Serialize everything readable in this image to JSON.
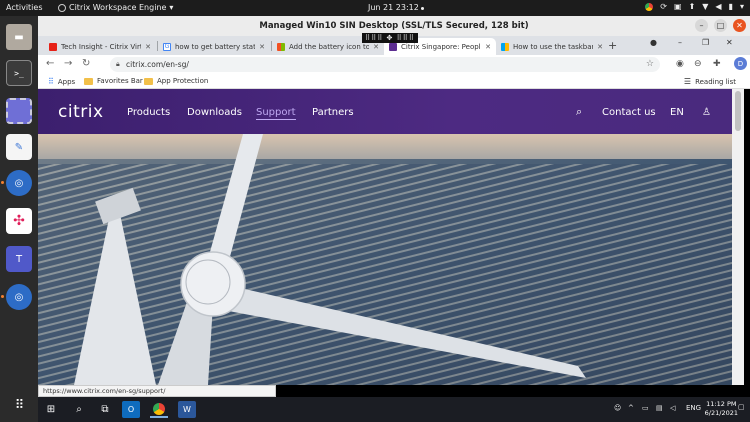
{
  "topbar": {
    "activities": "Activities",
    "app_name": "Citrix Workspace Engine",
    "clock": "Jun 21  23:12"
  },
  "citrix": {
    "title": "Managed Win10 SIN Desktop (SSL/TLS Secured, 128 bit)",
    "toolbar_handle": "⠿⠿⠿ ✥ ⠿⠿⠿"
  },
  "browser": {
    "tabs": [
      {
        "label": "Tech Insight - Citrix Virtual",
        "favicon_color": "#e62117"
      },
      {
        "label": "how to get battery status",
        "favicon_color": "#4285f4"
      },
      {
        "label": "Add the battery icon to th",
        "favicon_color": "#00a4ef"
      },
      {
        "label": "Citrix Singapore: People-c",
        "favicon_color": "#5c2d91"
      },
      {
        "label": "How to use the taskbar in",
        "favicon_color": "#00a4ef"
      }
    ],
    "new_tab": "+",
    "url": "citrix.com/en-sg/",
    "profile_initial": "D",
    "bookmarks": {
      "apps": "Apps",
      "favorites": "Favorites Bar",
      "app_protection": "App Protection",
      "reading_list": "Reading list"
    },
    "status_url": "https://www.citrix.com/en-sg/support/"
  },
  "site": {
    "logo": "citrix",
    "nav": [
      "Products",
      "Downloads",
      "Support",
      "Partners"
    ],
    "contact": "Contact us",
    "lang": "EN"
  },
  "taskbar": {
    "lang": "ENG",
    "time": "11:12 PM",
    "date": "6/21/2021"
  }
}
